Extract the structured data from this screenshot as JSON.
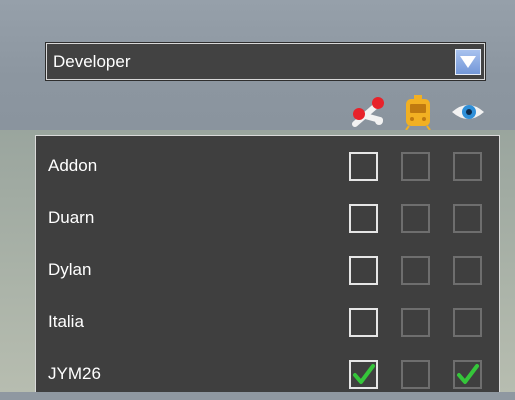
{
  "dropdown": {
    "selected": "Developer",
    "arrow_icon": "triangle-down-icon"
  },
  "columns": [
    {
      "icon": "signal-icon",
      "color": "#e8222a"
    },
    {
      "icon": "train-icon",
      "color": "#f2b022"
    },
    {
      "icon": "eye-icon",
      "color": "#2f8fd8"
    }
  ],
  "rows": [
    {
      "label": "Addon",
      "checks": [
        false,
        false,
        false
      ]
    },
    {
      "label": "Duarn",
      "checks": [
        false,
        false,
        false
      ]
    },
    {
      "label": "Dylan",
      "checks": [
        false,
        false,
        false
      ]
    },
    {
      "label": "Italia",
      "checks": [
        false,
        false,
        false
      ]
    },
    {
      "label": "JYM26",
      "checks": [
        true,
        false,
        true
      ]
    }
  ],
  "colors": {
    "panel": "#3f3f3f",
    "check": "#35c63a",
    "arrow": "#7c9fdc"
  }
}
